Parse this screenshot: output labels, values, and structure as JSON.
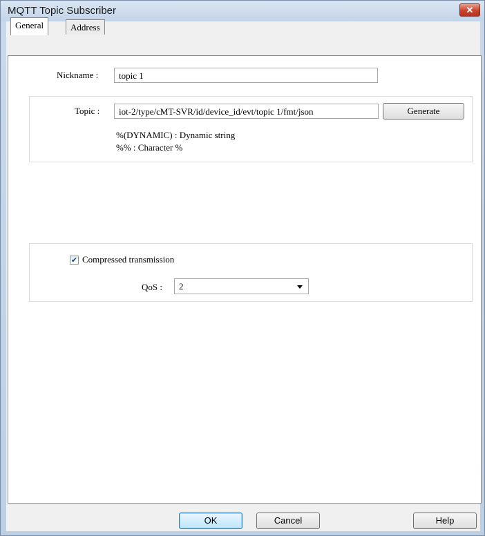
{
  "window": {
    "title": "MQTT Topic Subscriber",
    "close_glyph": "✕"
  },
  "tabs": [
    {
      "label": "General",
      "active": true
    },
    {
      "label": "Address",
      "active": false
    }
  ],
  "general": {
    "nickname_label": "Nickname :",
    "nickname_value": "topic 1",
    "topic_label": "Topic :",
    "topic_value": "iot-2/type/cMT-SVR/id/device_id/evt/topic 1/fmt/json",
    "generate_button": "Generate",
    "hint_dynamic": "%(DYNAMIC) : Dynamic string",
    "hint_percent": "%% : Character %",
    "compressed_label": "Compressed transmission",
    "compressed_checked": true,
    "check_glyph": "✔",
    "qos_label": "QoS :",
    "qos_value": "2"
  },
  "footer": {
    "ok_button": "OK",
    "cancel_button": "Cancel",
    "help_button": "Help"
  },
  "icons": {
    "close": "close-icon",
    "checkbox": "check-icon",
    "dropdown": "chevron-down-icon"
  }
}
